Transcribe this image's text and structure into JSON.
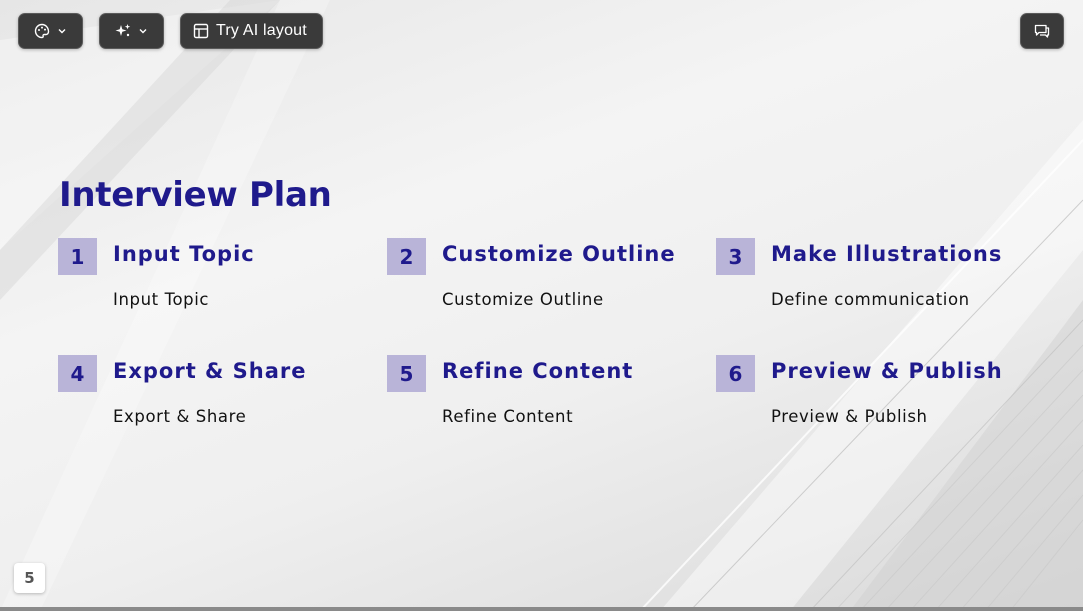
{
  "toolbar": {
    "theme_icon": "palette-icon",
    "ai_icon": "sparkles-icon",
    "layout_icon": "layout-icon",
    "layout_label": "Try AI layout",
    "comment_icon": "comment-icon",
    "dropdown_icon": "chevron-down-icon"
  },
  "slide": {
    "title": "Interview Plan",
    "items": [
      {
        "number": "1",
        "title": "Input Topic",
        "description": "Input Topic"
      },
      {
        "number": "2",
        "title": "Customize Outline",
        "description": "Customize Outline"
      },
      {
        "number": "3",
        "title": "Make Illustrations",
        "description": "Define communication"
      },
      {
        "number": "4",
        "title": "Export & Share",
        "description": "Export & Share"
      },
      {
        "number": "5",
        "title": "Refine Content",
        "description": "Refine Content"
      },
      {
        "number": "6",
        "title": "Preview & Publish",
        "description": "Preview & Publish"
      }
    ],
    "page_number": "5"
  },
  "colors": {
    "accent": "#1f1a8c",
    "number_badge_bg": "#b9b4d8",
    "toolbar_bg": "#3a3a3a"
  }
}
